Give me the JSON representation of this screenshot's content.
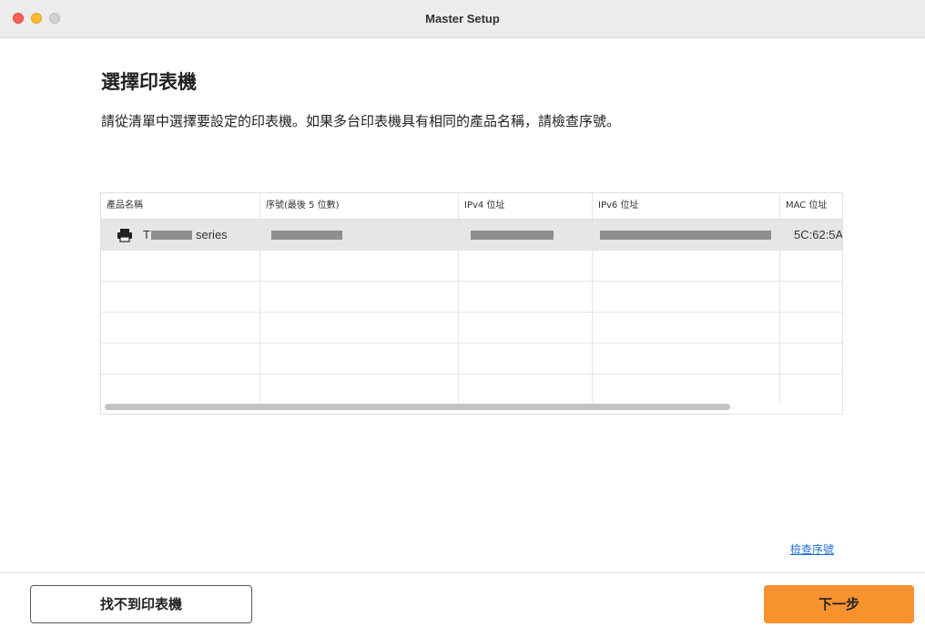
{
  "window": {
    "title": "Master Setup"
  },
  "page": {
    "heading": "選擇印表機",
    "description": "請從清單中選擇要設定的印表機。如果多台印表機具有相同的產品名稱，請檢查序號。"
  },
  "table": {
    "columns": [
      "產品名稱",
      "序號(最後 5 位數)",
      "IPv4 位址",
      "IPv6 位址",
      "MAC 位址"
    ],
    "rows": [
      {
        "product_prefix": "T",
        "product_suffix": "series",
        "serial": "",
        "ipv4": "",
        "ipv6": "",
        "mac": "5C:62:5A",
        "selected": true
      }
    ]
  },
  "links": {
    "check_serial": "檢查序號"
  },
  "footer": {
    "not_found_button": "找不到印表機",
    "next_button": "下一步"
  },
  "colors": {
    "accent": "#f7922f",
    "link": "#1a6fd1",
    "selected_row": "#e6e6e6"
  },
  "icons": {
    "row_icon": "printer-icon"
  }
}
